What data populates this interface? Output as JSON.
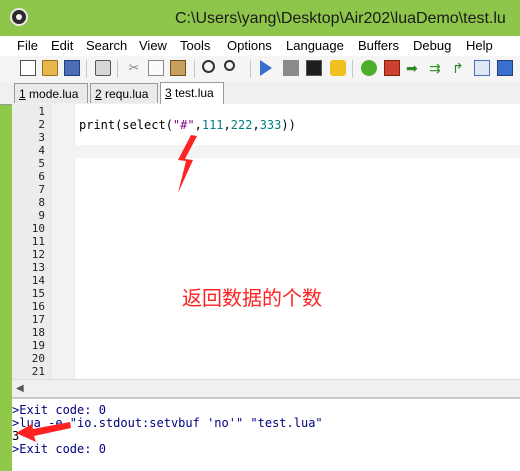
{
  "window": {
    "title": "C:\\Users\\yang\\Desktop\\Air202\\luaDemo\\test.lu"
  },
  "menu": [
    "File",
    "Edit",
    "Search",
    "View",
    "Tools",
    "Options",
    "Language",
    "Buffers",
    "Debug",
    "Help"
  ],
  "toolbar": {
    "icons": [
      "new-file-icon",
      "open-file-icon",
      "save-icon",
      "print-icon",
      "cut-icon",
      "copy-icon",
      "paste-icon",
      "find-icon",
      "replace-icon",
      "run-icon",
      "stop-icon",
      "terminal-icon",
      "tool-icon",
      "bug-icon",
      "bookmark-icon",
      "next-icon",
      "compile-icon",
      "refresh-icon",
      "console-icon",
      "exit-icon"
    ]
  },
  "tabs": [
    {
      "num": "1",
      "label": "mode.lua"
    },
    {
      "num": "2",
      "label": "requ.lua"
    },
    {
      "num": "3",
      "label": "test.lua"
    }
  ],
  "editor": {
    "line_numbers": [
      "1",
      "2",
      "3",
      "4",
      "5",
      "6",
      "7",
      "8",
      "9",
      "10",
      "11",
      "12",
      "13",
      "14",
      "15",
      "16",
      "17",
      "18",
      "19",
      "20",
      "21"
    ],
    "code": {
      "fn": "print(select(",
      "str": "\"#\"",
      "rest_a": ",",
      "n1": "111",
      "comma1": ",",
      "n2": "222",
      "comma2": ",",
      "n3": "333",
      "close": "))"
    }
  },
  "output": {
    "lines": [
      ">Exit code: 0",
      ">lua -e \"io.stdout:setvbuf 'no'\" \"test.lua\"",
      "3",
      ">Exit code: 0"
    ]
  },
  "annotation": {
    "text": "返回数据的个数"
  },
  "colors": {
    "annotation": "#ff2222",
    "titlebar": "#8ec64b",
    "keyword_blue": "#0000cc",
    "number_teal": "#007f7f",
    "string_purple": "#7f007f"
  }
}
